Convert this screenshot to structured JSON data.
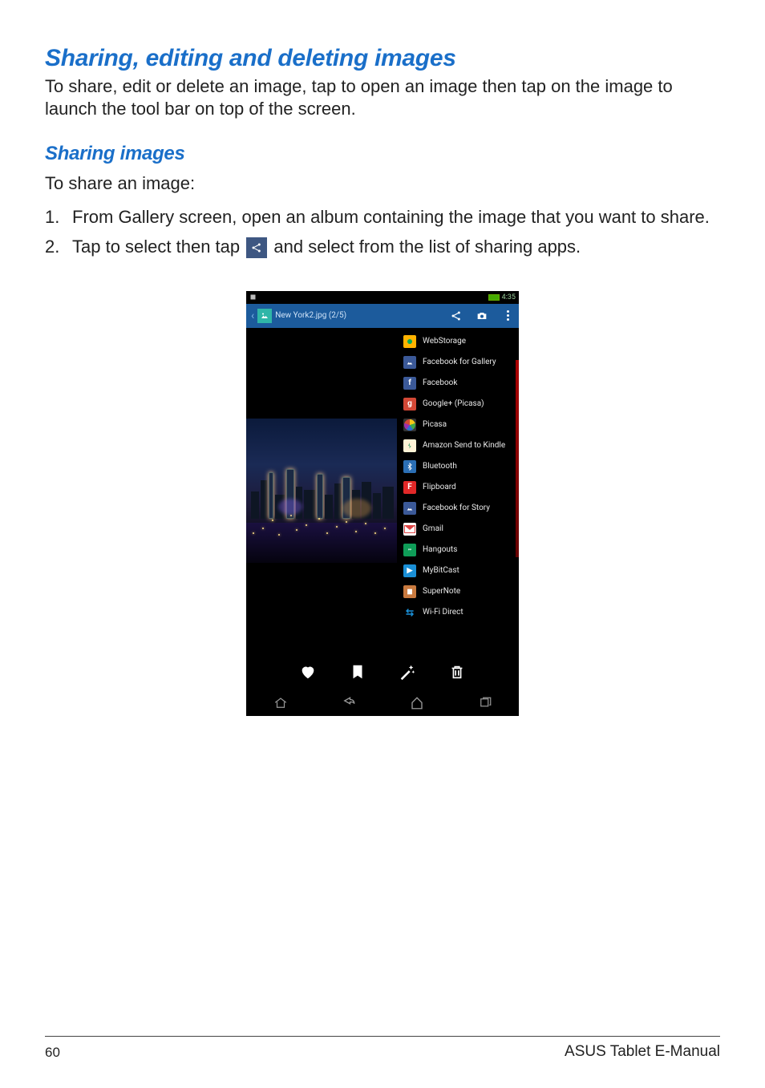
{
  "heading_main": "Sharing, editing and deleting images",
  "intro": "To share, edit or delete an image, tap to open an image then tap on the image to launch the tool bar on top of the screen.",
  "heading_sub": "Sharing images",
  "lead": "To share an image:",
  "steps": {
    "s1": "From Gallery screen, open an album containing the image that you want to share.",
    "s2a": "Tap to select then tap",
    "s2b": "and select from the list of sharing apps."
  },
  "device": {
    "status_time": "4:35",
    "appbar_title": "New York2.jpg (2/5)",
    "share_items": [
      {
        "label": "WebStorage",
        "iconClass": "ic-webstorage",
        "glyph": ""
      },
      {
        "label": "Facebook for Gallery",
        "iconClass": "ic-fbgallery",
        "glyph": ""
      },
      {
        "label": "Facebook",
        "iconClass": "ic-facebook",
        "glyph": "f"
      },
      {
        "label": "Google+ (Picasa)",
        "iconClass": "ic-gplus",
        "glyph": "g"
      },
      {
        "label": "Picasa",
        "iconClass": "ic-picasa",
        "glyph": ""
      },
      {
        "label": "Amazon Send to Kindle",
        "iconClass": "ic-kindle",
        "glyph": ""
      },
      {
        "label": "Bluetooth",
        "iconClass": "ic-bluetooth",
        "glyph": ""
      },
      {
        "label": "Flipboard",
        "iconClass": "ic-flipboard",
        "glyph": "F"
      },
      {
        "label": "Facebook for Story",
        "iconClass": "ic-fbstory",
        "glyph": ""
      },
      {
        "label": "Gmail",
        "iconClass": "ic-gmail",
        "glyph": ""
      },
      {
        "label": "Hangouts",
        "iconClass": "ic-hangouts",
        "glyph": ""
      },
      {
        "label": "MyBitCast",
        "iconClass": "ic-mybitcast",
        "glyph": ""
      },
      {
        "label": "SuperNote",
        "iconClass": "ic-supernote",
        "glyph": ""
      },
      {
        "label": "Wi-Fi Direct",
        "iconClass": "ic-wifi",
        "glyph": ""
      }
    ]
  },
  "footer": {
    "page": "60",
    "title": "ASUS Tablet E-Manual"
  }
}
